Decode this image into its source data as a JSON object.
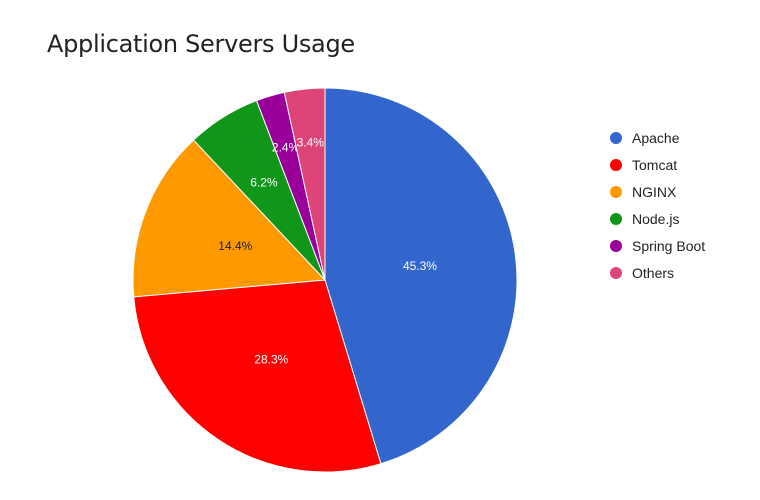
{
  "chart_data": {
    "type": "pie",
    "title": "Application Servers Usage",
    "slices": [
      {
        "label": "Apache",
        "value": 45.3,
        "display": "45.3%",
        "color": "#3366cc",
        "text_color": "#ffffff"
      },
      {
        "label": "Tomcat",
        "value": 28.3,
        "display": "28.3%",
        "color": "#ff0000",
        "text_color": "#ffffff"
      },
      {
        "label": "NGINX",
        "value": 14.4,
        "display": "14.4%",
        "color": "#ff9900",
        "text_color": "#222222"
      },
      {
        "label": "Node.js",
        "value": 6.2,
        "display": "6.2%",
        "color": "#109618",
        "text_color": "#ffffff"
      },
      {
        "label": "Spring Boot",
        "value": 2.4,
        "display": "2.4%",
        "color": "#990099",
        "text_color": "#ffffff"
      },
      {
        "label": "Others",
        "value": 3.4,
        "display": "3.4%",
        "color": "#dd4477",
        "text_color": "#ffffff"
      }
    ],
    "legend_position": "right"
  }
}
